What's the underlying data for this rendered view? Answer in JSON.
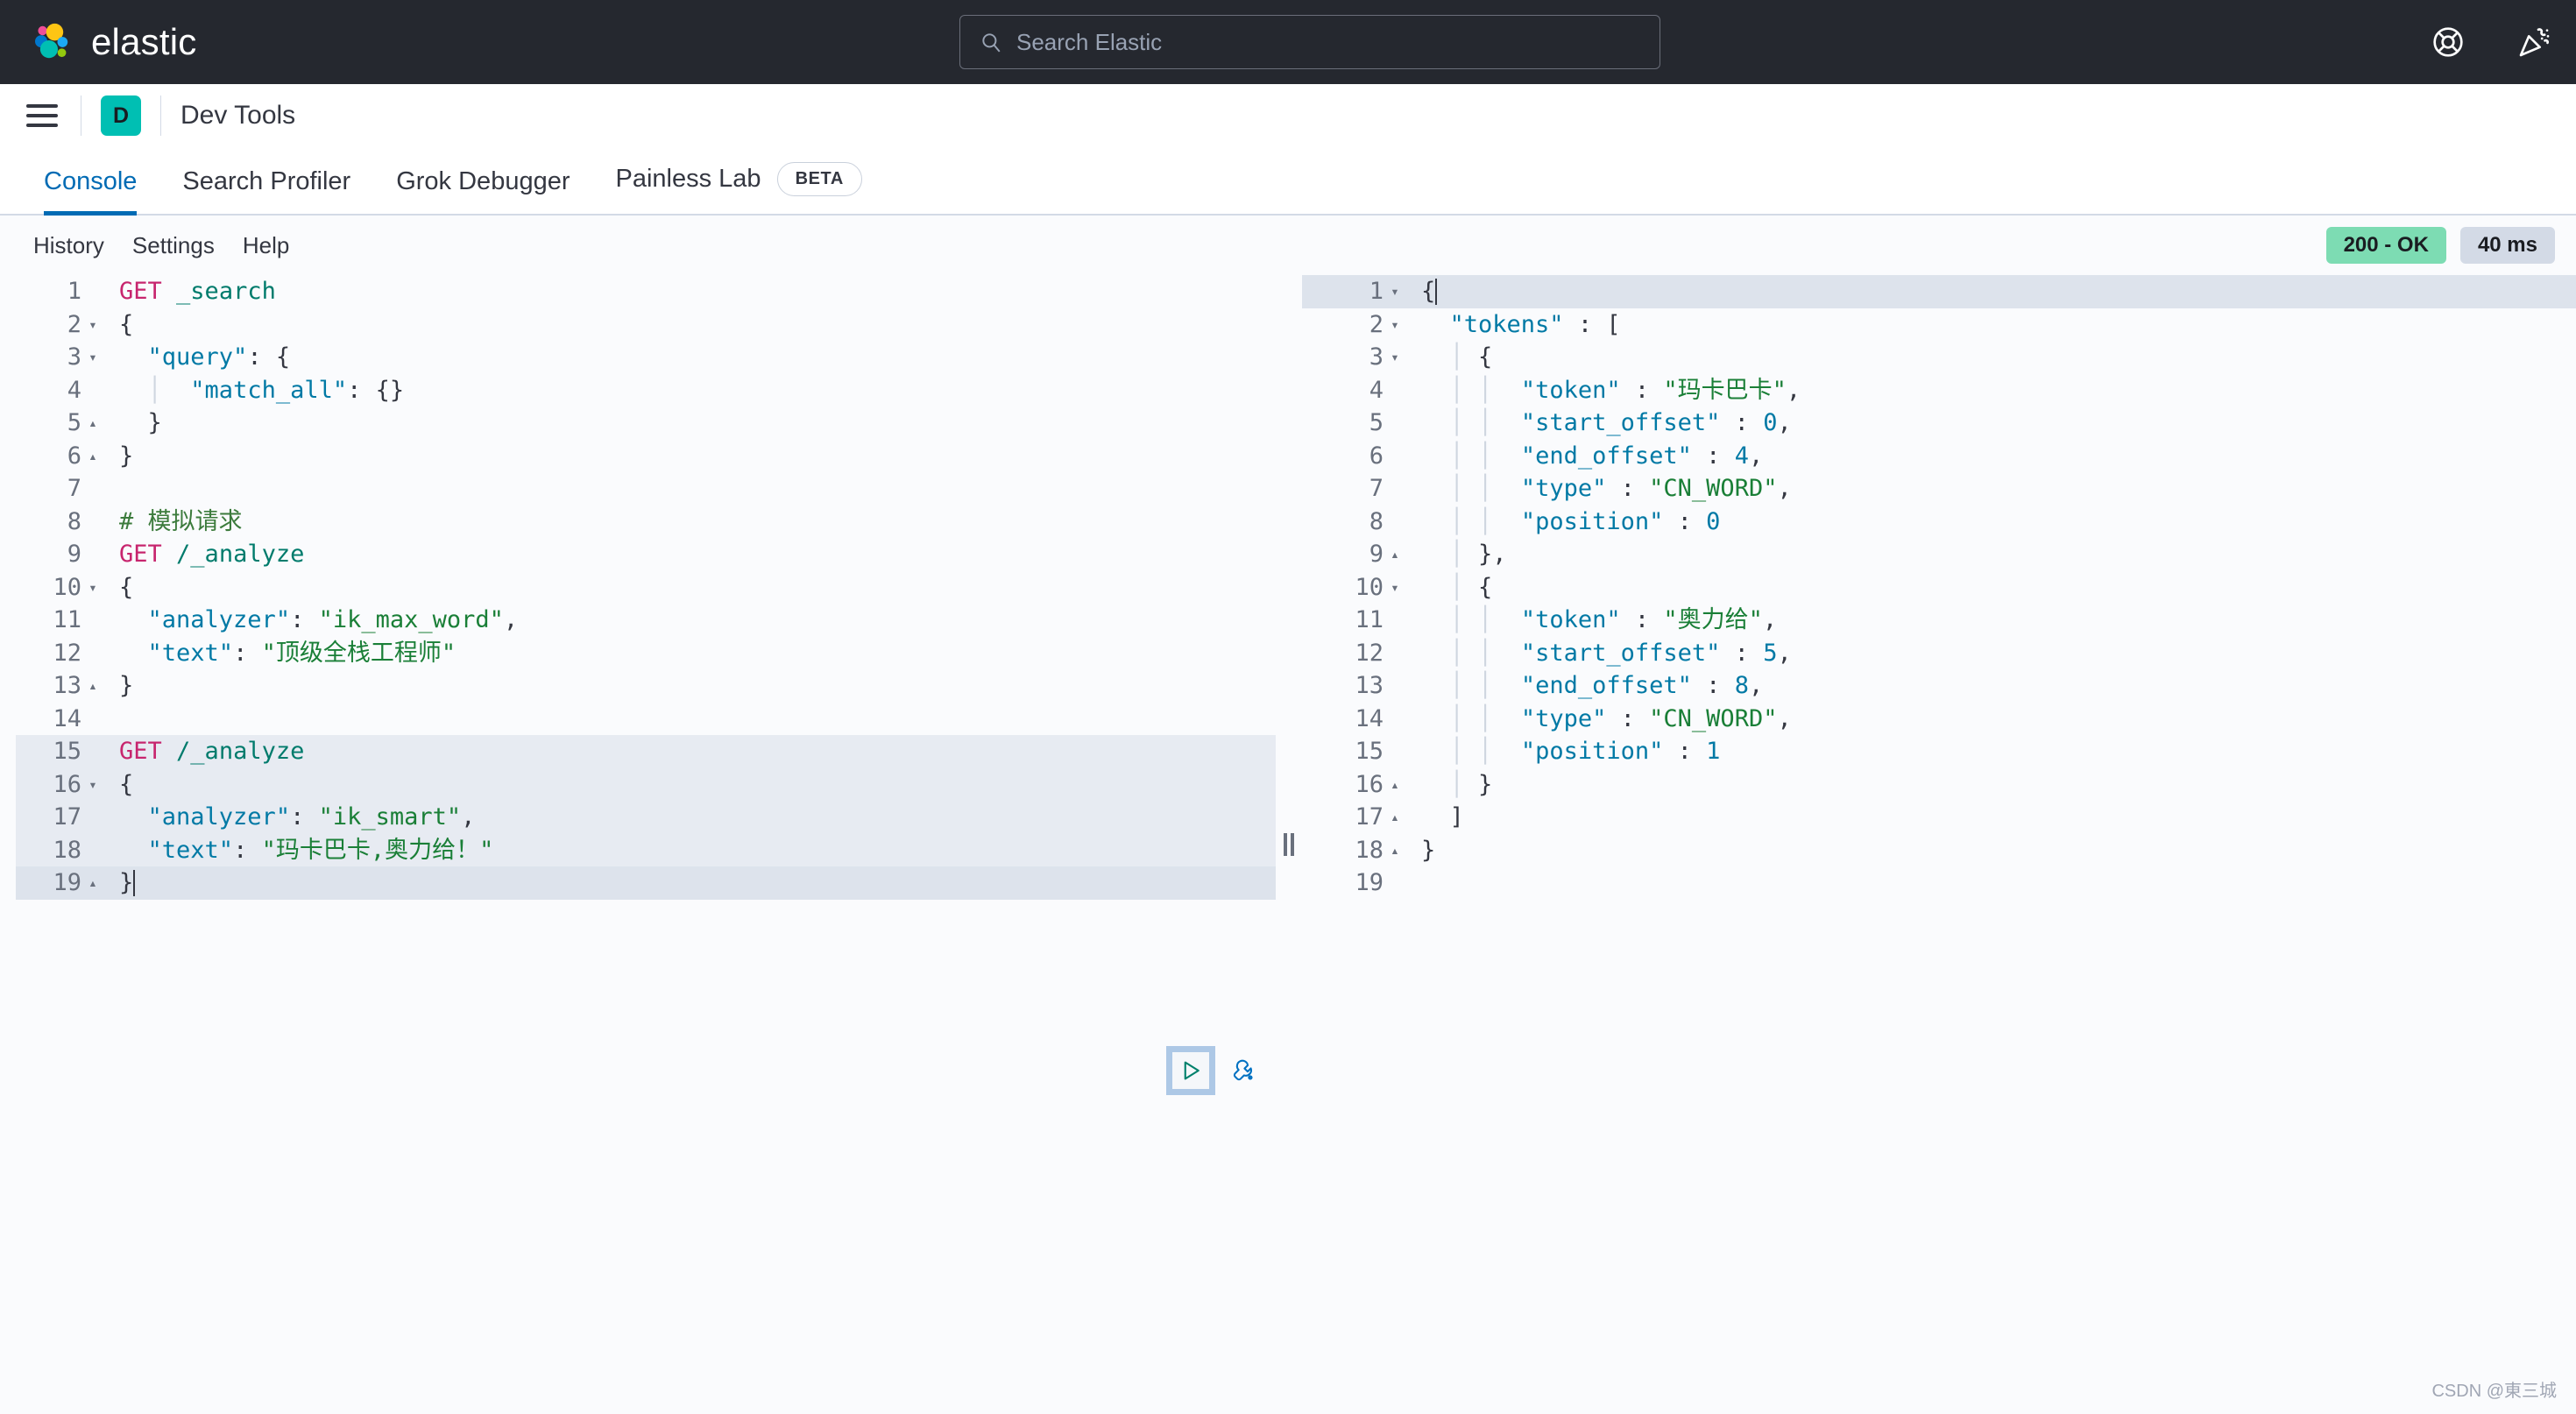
{
  "header": {
    "brand": "elastic",
    "logo_icon": "elastic-logo-icon",
    "search": {
      "placeholder": "Search Elastic",
      "value": "",
      "icon": "search-icon"
    },
    "help_icon": "life-ring-help-icon",
    "whats_new_icon": "party-popper-icon",
    "background": "#25282f"
  },
  "breadcrumb": {
    "menu_icon": "hamburger-menu-icon",
    "app_initial": "D",
    "app_badge_color": "#00BFB3",
    "title": "Dev Tools"
  },
  "tabs": [
    {
      "label": "Console",
      "active": true
    },
    {
      "label": "Search Profiler",
      "active": false
    },
    {
      "label": "Grok Debugger",
      "active": false
    },
    {
      "label": "Painless Lab",
      "active": false,
      "badge": "BETA"
    }
  ],
  "console_toolbar": {
    "buttons": [
      "History",
      "Settings",
      "Help"
    ],
    "status": "200 - OK",
    "status_color": "#7DDCB3",
    "duration": "40 ms",
    "duration_color": "#d3dae6"
  },
  "request_editor": {
    "name": "request-editor",
    "run_icon": "play-triangle-icon",
    "wrench_icon": "wrench-icon",
    "lines": [
      {
        "n": "1",
        "fold": "",
        "hl": "",
        "tokens": [
          {
            "t": "GET",
            "c": "k-method"
          },
          {
            "t": " ",
            "c": "k-punct"
          },
          {
            "t": "_search",
            "c": "k-url"
          }
        ]
      },
      {
        "n": "2",
        "fold": "▾",
        "hl": "",
        "tokens": [
          {
            "t": "{",
            "c": "k-punct"
          }
        ]
      },
      {
        "n": "3",
        "fold": "▾",
        "hl": "",
        "tokens": [
          {
            "t": "  ",
            "c": "k-punct"
          },
          {
            "t": "\"query\"",
            "c": "k-key"
          },
          {
            "t": ": {",
            "c": "k-punct"
          }
        ]
      },
      {
        "n": "4",
        "fold": "",
        "hl": "",
        "tokens": [
          {
            "t": "  ",
            "c": "k-punct"
          },
          {
            "t": "│",
            "c": "guide"
          },
          {
            "t": "  ",
            "c": "k-punct"
          },
          {
            "t": "\"match_all\"",
            "c": "k-key"
          },
          {
            "t": ": {}",
            "c": "k-punct"
          }
        ]
      },
      {
        "n": "5",
        "fold": "▴",
        "hl": "",
        "tokens": [
          {
            "t": "  }",
            "c": "k-punct"
          }
        ]
      },
      {
        "n": "6",
        "fold": "▴",
        "hl": "",
        "tokens": [
          {
            "t": "}",
            "c": "k-punct"
          }
        ]
      },
      {
        "n": "7",
        "fold": "",
        "hl": "",
        "tokens": []
      },
      {
        "n": "8",
        "fold": "",
        "hl": "",
        "tokens": [
          {
            "t": "# 模拟请求",
            "c": "k-comment"
          }
        ]
      },
      {
        "n": "9",
        "fold": "",
        "hl": "",
        "tokens": [
          {
            "t": "GET",
            "c": "k-method"
          },
          {
            "t": " ",
            "c": "k-punct"
          },
          {
            "t": "/_analyze",
            "c": "k-url"
          }
        ]
      },
      {
        "n": "10",
        "fold": "▾",
        "hl": "",
        "tokens": [
          {
            "t": "{",
            "c": "k-punct"
          }
        ]
      },
      {
        "n": "11",
        "fold": "",
        "hl": "",
        "tokens": [
          {
            "t": "  ",
            "c": "k-punct"
          },
          {
            "t": "\"analyzer\"",
            "c": "k-key"
          },
          {
            "t": ": ",
            "c": "k-punct"
          },
          {
            "t": "\"ik_max_word\"",
            "c": "k-str"
          },
          {
            "t": ",",
            "c": "k-punct"
          }
        ]
      },
      {
        "n": "12",
        "fold": "",
        "hl": "",
        "tokens": [
          {
            "t": "  ",
            "c": "k-punct"
          },
          {
            "t": "\"text\"",
            "c": "k-key"
          },
          {
            "t": ": ",
            "c": "k-punct"
          },
          {
            "t": "\"顶级全栈工程师\"",
            "c": "k-str"
          }
        ]
      },
      {
        "n": "13",
        "fold": "▴",
        "hl": "",
        "tokens": [
          {
            "t": "}",
            "c": "k-punct"
          }
        ]
      },
      {
        "n": "14",
        "fold": "",
        "hl": "",
        "tokens": []
      },
      {
        "n": "15",
        "fold": "",
        "hl": "hl-a",
        "tokens": [
          {
            "t": "GET",
            "c": "k-method"
          },
          {
            "t": " ",
            "c": "k-punct"
          },
          {
            "t": "/_analyze",
            "c": "k-url"
          }
        ]
      },
      {
        "n": "16",
        "fold": "▾",
        "hl": "hl-a",
        "tokens": [
          {
            "t": "{",
            "c": "k-punct"
          }
        ]
      },
      {
        "n": "17",
        "fold": "",
        "hl": "hl-a",
        "tokens": [
          {
            "t": "  ",
            "c": "k-punct"
          },
          {
            "t": "\"analyzer\"",
            "c": "k-key"
          },
          {
            "t": ": ",
            "c": "k-punct"
          },
          {
            "t": "\"ik_smart\"",
            "c": "k-str"
          },
          {
            "t": ",",
            "c": "k-punct"
          }
        ]
      },
      {
        "n": "18",
        "fold": "",
        "hl": "hl-a",
        "tokens": [
          {
            "t": "  ",
            "c": "k-punct"
          },
          {
            "t": "\"text\"",
            "c": "k-key"
          },
          {
            "t": ": ",
            "c": "k-punct"
          },
          {
            "t": "\"玛卡巴卡,奥力给！\"",
            "c": "k-str"
          }
        ]
      },
      {
        "n": "19",
        "fold": "▴",
        "hl": "hl-b",
        "tokens": [
          {
            "t": "}",
            "c": "k-punct"
          }
        ],
        "caret": true
      }
    ]
  },
  "response_editor": {
    "name": "response-editor",
    "lines": [
      {
        "n": "1",
        "fold": "▾",
        "hl": "hl-b",
        "caret": true,
        "tokens": [
          {
            "t": "{",
            "c": "k-punct"
          }
        ]
      },
      {
        "n": "2",
        "fold": "▾",
        "hl": "",
        "tokens": [
          {
            "t": "  ",
            "c": "k-punct"
          },
          {
            "t": "\"tokens\"",
            "c": "k-key"
          },
          {
            "t": " : [",
            "c": "k-punct"
          }
        ]
      },
      {
        "n": "3",
        "fold": "▾",
        "hl": "",
        "tokens": [
          {
            "t": "  ",
            "c": "k-punct"
          },
          {
            "t": "│",
            "c": "guide"
          },
          {
            "t": " {",
            "c": "k-punct"
          }
        ]
      },
      {
        "n": "4",
        "fold": "",
        "hl": "",
        "tokens": [
          {
            "t": "  ",
            "c": "k-punct"
          },
          {
            "t": "│",
            "c": "guide"
          },
          {
            "t": " ",
            "c": "k-punct"
          },
          {
            "t": "│",
            "c": "guide"
          },
          {
            "t": "  ",
            "c": "k-punct"
          },
          {
            "t": "\"token\"",
            "c": "k-key"
          },
          {
            "t": " : ",
            "c": "k-punct"
          },
          {
            "t": "\"玛卡巴卡\"",
            "c": "k-str"
          },
          {
            "t": ",",
            "c": "k-punct"
          }
        ]
      },
      {
        "n": "5",
        "fold": "",
        "hl": "",
        "tokens": [
          {
            "t": "  ",
            "c": "k-punct"
          },
          {
            "t": "│",
            "c": "guide"
          },
          {
            "t": " ",
            "c": "k-punct"
          },
          {
            "t": "│",
            "c": "guide"
          },
          {
            "t": "  ",
            "c": "k-punct"
          },
          {
            "t": "\"start_offset\"",
            "c": "k-key"
          },
          {
            "t": " : ",
            "c": "k-punct"
          },
          {
            "t": "0",
            "c": "k-num"
          },
          {
            "t": ",",
            "c": "k-punct"
          }
        ]
      },
      {
        "n": "6",
        "fold": "",
        "hl": "",
        "tokens": [
          {
            "t": "  ",
            "c": "k-punct"
          },
          {
            "t": "│",
            "c": "guide"
          },
          {
            "t": " ",
            "c": "k-punct"
          },
          {
            "t": "│",
            "c": "guide"
          },
          {
            "t": "  ",
            "c": "k-punct"
          },
          {
            "t": "\"end_offset\"",
            "c": "k-key"
          },
          {
            "t": " : ",
            "c": "k-punct"
          },
          {
            "t": "4",
            "c": "k-num"
          },
          {
            "t": ",",
            "c": "k-punct"
          }
        ]
      },
      {
        "n": "7",
        "fold": "",
        "hl": "",
        "tokens": [
          {
            "t": "  ",
            "c": "k-punct"
          },
          {
            "t": "│",
            "c": "guide"
          },
          {
            "t": " ",
            "c": "k-punct"
          },
          {
            "t": "│",
            "c": "guide"
          },
          {
            "t": "  ",
            "c": "k-punct"
          },
          {
            "t": "\"type\"",
            "c": "k-key"
          },
          {
            "t": " : ",
            "c": "k-punct"
          },
          {
            "t": "\"CN_WORD\"",
            "c": "k-str"
          },
          {
            "t": ",",
            "c": "k-punct"
          }
        ]
      },
      {
        "n": "8",
        "fold": "",
        "hl": "",
        "tokens": [
          {
            "t": "  ",
            "c": "k-punct"
          },
          {
            "t": "│",
            "c": "guide"
          },
          {
            "t": " ",
            "c": "k-punct"
          },
          {
            "t": "│",
            "c": "guide"
          },
          {
            "t": "  ",
            "c": "k-punct"
          },
          {
            "t": "\"position\"",
            "c": "k-key"
          },
          {
            "t": " : ",
            "c": "k-punct"
          },
          {
            "t": "0",
            "c": "k-num"
          }
        ]
      },
      {
        "n": "9",
        "fold": "▴",
        "hl": "",
        "tokens": [
          {
            "t": "  ",
            "c": "k-punct"
          },
          {
            "t": "│",
            "c": "guide"
          },
          {
            "t": " },",
            "c": "k-punct"
          }
        ]
      },
      {
        "n": "10",
        "fold": "▾",
        "hl": "",
        "tokens": [
          {
            "t": "  ",
            "c": "k-punct"
          },
          {
            "t": "│",
            "c": "guide"
          },
          {
            "t": " {",
            "c": "k-punct"
          }
        ]
      },
      {
        "n": "11",
        "fold": "",
        "hl": "",
        "tokens": [
          {
            "t": "  ",
            "c": "k-punct"
          },
          {
            "t": "│",
            "c": "guide"
          },
          {
            "t": " ",
            "c": "k-punct"
          },
          {
            "t": "│",
            "c": "guide"
          },
          {
            "t": "  ",
            "c": "k-punct"
          },
          {
            "t": "\"token\"",
            "c": "k-key"
          },
          {
            "t": " : ",
            "c": "k-punct"
          },
          {
            "t": "\"奥力给\"",
            "c": "k-str"
          },
          {
            "t": ",",
            "c": "k-punct"
          }
        ]
      },
      {
        "n": "12",
        "fold": "",
        "hl": "",
        "tokens": [
          {
            "t": "  ",
            "c": "k-punct"
          },
          {
            "t": "│",
            "c": "guide"
          },
          {
            "t": " ",
            "c": "k-punct"
          },
          {
            "t": "│",
            "c": "guide"
          },
          {
            "t": "  ",
            "c": "k-punct"
          },
          {
            "t": "\"start_offset\"",
            "c": "k-key"
          },
          {
            "t": " : ",
            "c": "k-punct"
          },
          {
            "t": "5",
            "c": "k-num"
          },
          {
            "t": ",",
            "c": "k-punct"
          }
        ]
      },
      {
        "n": "13",
        "fold": "",
        "hl": "",
        "tokens": [
          {
            "t": "  ",
            "c": "k-punct"
          },
          {
            "t": "│",
            "c": "guide"
          },
          {
            "t": " ",
            "c": "k-punct"
          },
          {
            "t": "│",
            "c": "guide"
          },
          {
            "t": "  ",
            "c": "k-punct"
          },
          {
            "t": "\"end_offset\"",
            "c": "k-key"
          },
          {
            "t": " : ",
            "c": "k-punct"
          },
          {
            "t": "8",
            "c": "k-num"
          },
          {
            "t": ",",
            "c": "k-punct"
          }
        ]
      },
      {
        "n": "14",
        "fold": "",
        "hl": "",
        "tokens": [
          {
            "t": "  ",
            "c": "k-punct"
          },
          {
            "t": "│",
            "c": "guide"
          },
          {
            "t": " ",
            "c": "k-punct"
          },
          {
            "t": "│",
            "c": "guide"
          },
          {
            "t": "  ",
            "c": "k-punct"
          },
          {
            "t": "\"type\"",
            "c": "k-key"
          },
          {
            "t": " : ",
            "c": "k-punct"
          },
          {
            "t": "\"CN_WORD\"",
            "c": "k-str"
          },
          {
            "t": ",",
            "c": "k-punct"
          }
        ]
      },
      {
        "n": "15",
        "fold": "",
        "hl": "",
        "tokens": [
          {
            "t": "  ",
            "c": "k-punct"
          },
          {
            "t": "│",
            "c": "guide"
          },
          {
            "t": " ",
            "c": "k-punct"
          },
          {
            "t": "│",
            "c": "guide"
          },
          {
            "t": "  ",
            "c": "k-punct"
          },
          {
            "t": "\"position\"",
            "c": "k-key"
          },
          {
            "t": " : ",
            "c": "k-punct"
          },
          {
            "t": "1",
            "c": "k-num"
          }
        ]
      },
      {
        "n": "16",
        "fold": "▴",
        "hl": "",
        "tokens": [
          {
            "t": "  ",
            "c": "k-punct"
          },
          {
            "t": "│",
            "c": "guide"
          },
          {
            "t": " }",
            "c": "k-punct"
          }
        ]
      },
      {
        "n": "17",
        "fold": "▴",
        "hl": "",
        "tokens": [
          {
            "t": "  ]",
            "c": "k-punct"
          }
        ]
      },
      {
        "n": "18",
        "fold": "▴",
        "hl": "",
        "tokens": [
          {
            "t": "}",
            "c": "k-punct"
          }
        ]
      },
      {
        "n": "19",
        "fold": "",
        "hl": "",
        "tokens": []
      }
    ]
  },
  "splitter": {
    "icon": "drag-handle-icon"
  },
  "watermark": "CSDN @東三城"
}
